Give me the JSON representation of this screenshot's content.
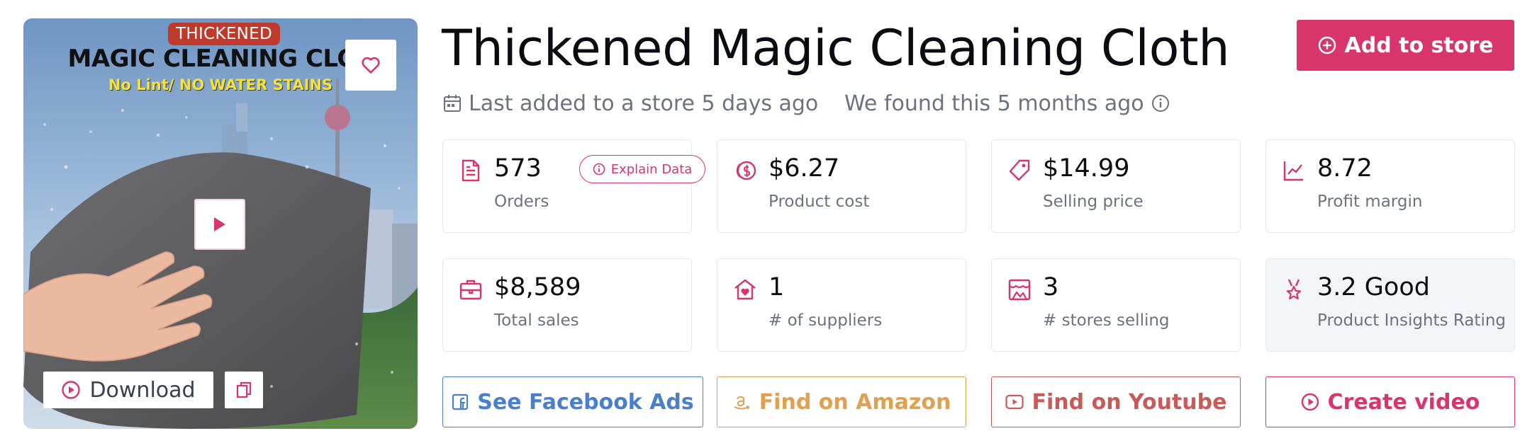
{
  "product": {
    "title": "Thickened Magic Cleaning Cloth",
    "last_added": "Last added to a store 5 days ago",
    "found": "We found this 5 months ago"
  },
  "image": {
    "badge": "THICKENED",
    "headline": "MAGIC CLEANING CLOT",
    "subline": "No Lint/ NO WATER STAINS",
    "download_label": "Download"
  },
  "actions_top": {
    "add_label": "Add to store"
  },
  "explain_label": "Explain Data",
  "stats": [
    {
      "value": "573",
      "label": "Orders",
      "icon": "document-icon"
    },
    {
      "value": "$6.27",
      "label": "Product cost",
      "icon": "coins-icon"
    },
    {
      "value": "$14.99",
      "label": "Selling price",
      "icon": "price-tag-icon"
    },
    {
      "value": "8.72",
      "label": "Profit margin",
      "icon": "trend-chart-icon"
    },
    {
      "value": "$8,589",
      "label": "Total sales",
      "icon": "briefcase-icon"
    },
    {
      "value": "1",
      "label": "# of suppliers",
      "icon": "home-heart-icon"
    },
    {
      "value": "3",
      "label": "# stores selling",
      "icon": "store-icon"
    },
    {
      "value": "3.2 Good",
      "label": "Product Insights Rating",
      "icon": "award-icon"
    }
  ],
  "action_buttons": [
    {
      "label": "See Facebook Ads",
      "icon": "facebook-icon",
      "color": "#4a7fc9"
    },
    {
      "label": "Find on Amazon",
      "icon": "amazon-icon",
      "color": "#e0a050"
    },
    {
      "label": "Find on Youtube",
      "icon": "youtube-icon",
      "color": "#c85a5a"
    },
    {
      "label": "Create video",
      "icon": "play-circle-icon",
      "color": "#d8366a"
    }
  ],
  "colors": {
    "accent": "#d8366a",
    "text": "#0b0b12",
    "muted": "#6b7280",
    "border": "#e5e7eb"
  }
}
